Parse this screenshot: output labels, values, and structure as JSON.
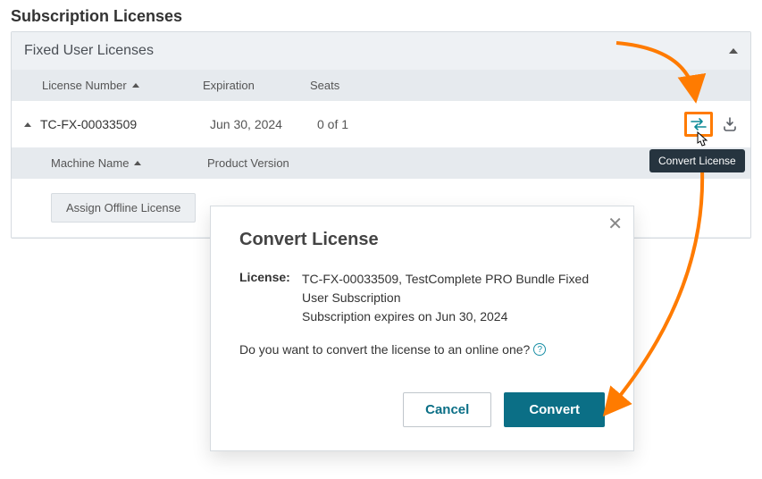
{
  "page_title": "Subscription Licenses",
  "panel": {
    "title": "Fixed User Licenses",
    "columns": {
      "license_number": "License Number",
      "expiration": "Expiration",
      "seats": "Seats"
    },
    "sub_columns": {
      "machine_name": "Machine Name",
      "product_version": "Product Version"
    },
    "row": {
      "license_number": "TC-FX-00033509",
      "expiration": "Jun 30, 2024",
      "seats": "0 of 1"
    },
    "assign_button": "Assign Offline License",
    "tooltip": "Convert License"
  },
  "modal": {
    "title": "Convert License",
    "license_label": "License:",
    "license_line1": "TC-FX-00033509, TestComplete PRO Bundle Fixed User Subscription",
    "license_line2": "Subscription expires on Jun 30, 2024",
    "question": "Do you want to convert the license to an online one?",
    "cancel": "Cancel",
    "convert": "Convert",
    "help": "?"
  },
  "icons": {
    "close": "✕"
  }
}
